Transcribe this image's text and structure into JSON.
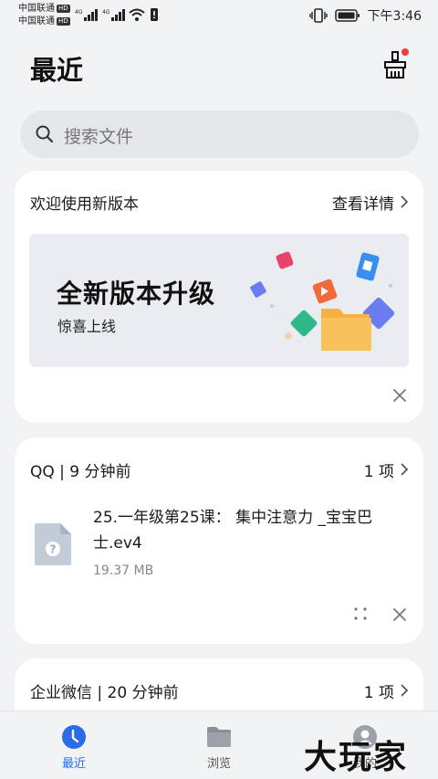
{
  "status_bar": {
    "carrier1": "中国联通",
    "carrier2": "中国联通",
    "hd_badge": "HD",
    "net1": "4G",
    "net2": "4G",
    "time": "下午3:46"
  },
  "header": {
    "title": "最近",
    "clean_icon": "broom-icon",
    "badge_color": "#e8403a"
  },
  "search": {
    "placeholder": "搜索文件",
    "icon": "search-icon"
  },
  "welcome_card": {
    "title": "欢迎使用新版本",
    "more_label": "查看详情",
    "banner_title": "全新版本升级",
    "banner_subtitle": "惊喜上线"
  },
  "qq_card": {
    "title": "QQ | 9 分钟前",
    "count_label": "1 项",
    "file_name": "25.一年级第25课： 集中注意力 _宝宝巴士.ev4",
    "file_size": "19.37 MB",
    "file_icon": "unknown-file-icon"
  },
  "wechat_card": {
    "title": "企业微信 | 20 分钟前",
    "count_label": "1 项"
  },
  "bottom_nav": {
    "items": [
      {
        "label": "最近",
        "icon": "clock-icon",
        "active": true
      },
      {
        "label": "浏览",
        "icon": "folder-icon",
        "active": false
      },
      {
        "label": "我的",
        "icon": "person-icon",
        "active": false
      }
    ],
    "active_color": "#2b6bea"
  },
  "watermark": "大玩家"
}
